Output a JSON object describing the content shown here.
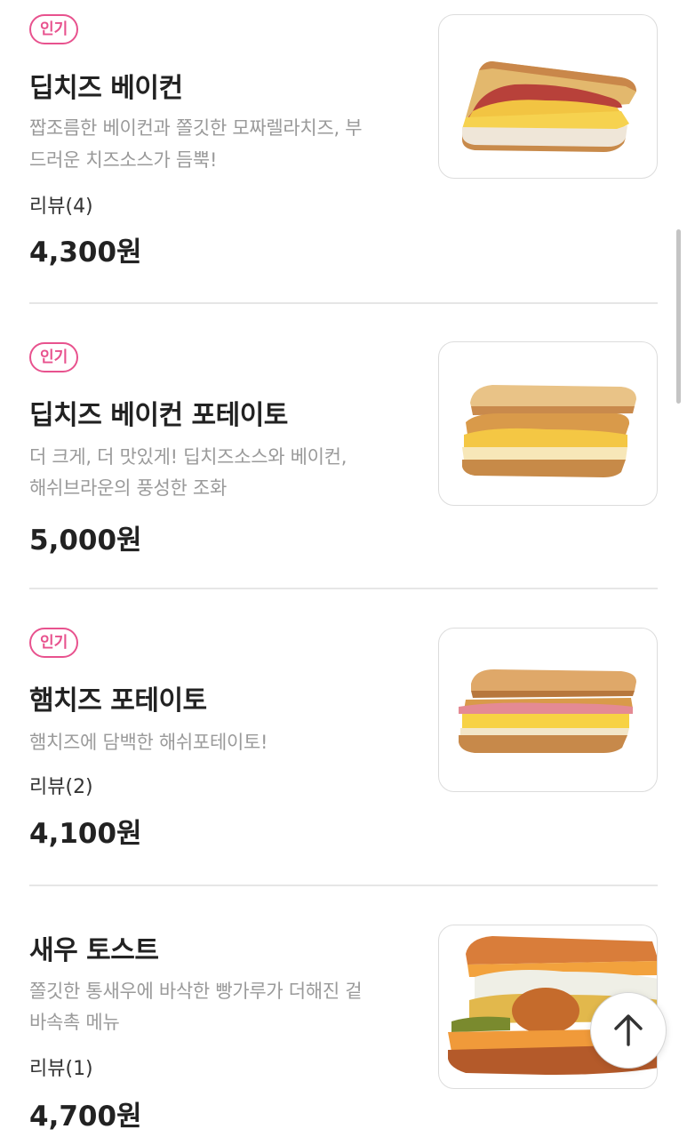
{
  "menu": {
    "items": [
      {
        "badge": "인기",
        "name": "딥치즈 베이컨",
        "description_lines": [
          "짭조름한 베이컨과 쫄깃한 모짜렐라치즈, 부",
          "드러운 치즈소스가 듬뿍!"
        ],
        "review": "리뷰(4)",
        "price": "4,300원",
        "image_icon": "sandwich-image"
      },
      {
        "badge": "인기",
        "name": "딥치즈 베이컨 포테이토",
        "description_lines": [
          "더 크게, 더 맛있게! 딥치즈소스와 베이컨,",
          "해쉬브라운의 풍성한 조화"
        ],
        "review": "",
        "price": "5,000원",
        "image_icon": "sandwich-image"
      },
      {
        "badge": "인기",
        "name": "햄치즈 포테이토",
        "description_lines": [
          "햄치즈에 담백한 해쉬포테이토!"
        ],
        "review": "리뷰(2)",
        "price": "4,100원",
        "image_icon": "sandwich-image"
      },
      {
        "badge": "",
        "name": "새우 토스트",
        "description_lines": [
          "쫄깃한 통새우에 바삭한 빵가루가 더해진 겉",
          "바속촉 메뉴"
        ],
        "review": "리뷰(1)",
        "price": "4,700원",
        "image_icon": "sandwich-image"
      }
    ]
  },
  "colors": {
    "badge": "#e8528e",
    "title": "#222222",
    "description": "#9a9a9a",
    "divider": "#e6e6e6"
  },
  "scroll_to_top": {
    "icon": "arrow-up-icon"
  }
}
